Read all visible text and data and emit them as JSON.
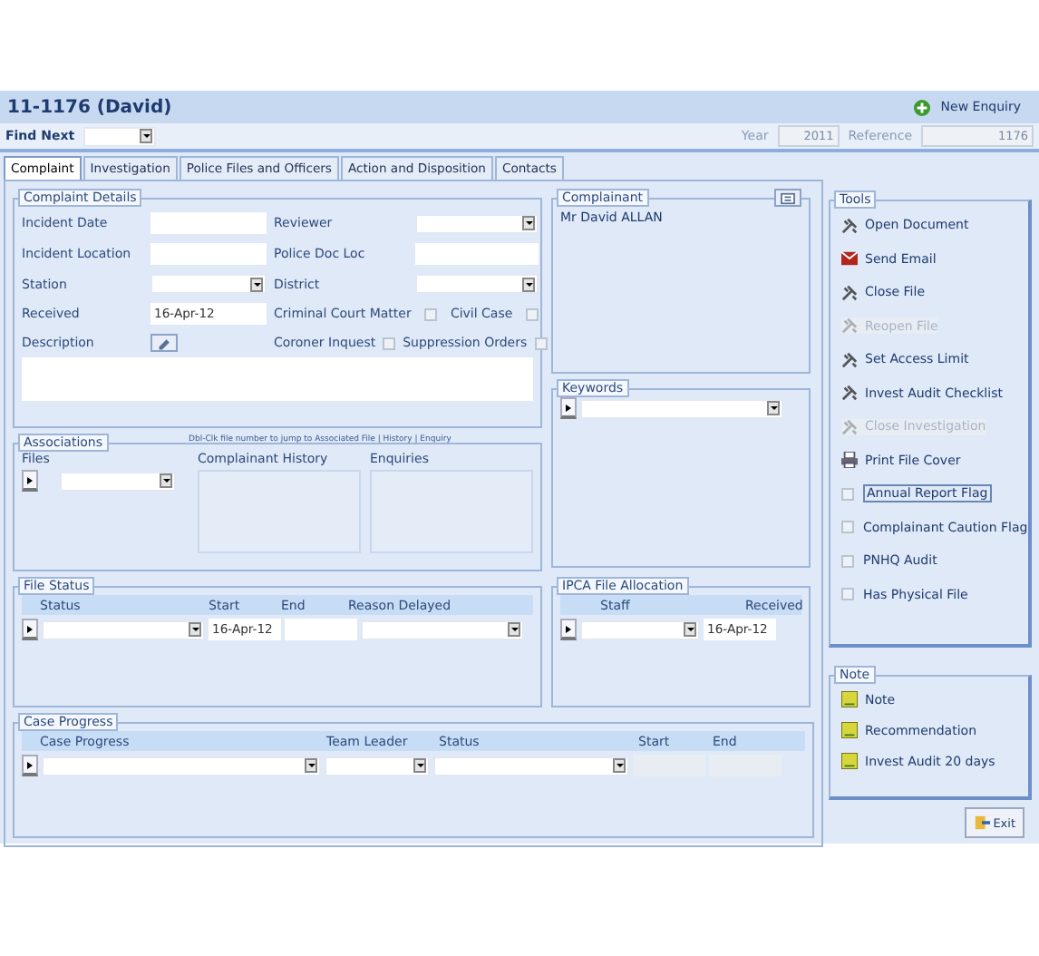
{
  "title": "11-1176 (David)",
  "new_enquiry": "New Enquiry",
  "find_next": {
    "label": "Find Next"
  },
  "year": {
    "label": "Year",
    "value": "2011"
  },
  "reference": {
    "label": "Reference",
    "value": "1176"
  },
  "tabs": [
    {
      "label": "Complaint",
      "selected": true
    },
    {
      "label": "Investigation",
      "selected": false
    },
    {
      "label": "Police Files and Officers",
      "selected": false
    },
    {
      "label": "Action and Disposition",
      "selected": false
    },
    {
      "label": "Contacts",
      "selected": false
    }
  ],
  "complaint_details": {
    "title": "Complaint Details",
    "rows": [
      {
        "left": {
          "label": "Incident Date",
          "kind": "text"
        },
        "right": {
          "label": "Reviewer",
          "kind": "dropdown"
        }
      },
      {
        "left": {
          "label": "Incident Location",
          "kind": "text"
        },
        "right": {
          "label": "Police Doc Loc",
          "kind": "text"
        }
      },
      {
        "left": {
          "label": "Station",
          "kind": "dropdown"
        },
        "right": {
          "label": "District",
          "kind": "dropdown"
        }
      },
      {
        "left": {
          "label": "Received",
          "kind": "text",
          "value": "16-Apr-12"
        },
        "right": {
          "kind": "checks",
          "checks": [
            {
              "label": "Criminal Court Matter",
              "checked": false
            },
            {
              "label": "Civil Case",
              "checked": false
            }
          ]
        }
      },
      {
        "left": {
          "label": "Description",
          "kind": "memo"
        },
        "right": {
          "kind": "checks",
          "checks": [
            {
              "label": "Coroner Inquest",
              "checked": false
            },
            {
              "label": "Suppression Orders",
              "checked": false
            }
          ]
        }
      }
    ]
  },
  "complainant": {
    "title": "Complainant",
    "name": "Mr David ALLAN"
  },
  "keywords": {
    "title": "Keywords"
  },
  "associations": {
    "title": "Associations",
    "hint": "Dbl-Clk file number to jump to Associated File | History | Enquiry",
    "lists": [
      {
        "title": "Files",
        "kind": "subform"
      },
      {
        "title": "Complainant History",
        "kind": "list"
      },
      {
        "title": "Enquiries",
        "kind": "list"
      }
    ]
  },
  "file_status": {
    "title": "File Status",
    "columns": [
      "Status",
      "Start",
      "End",
      "Reason Delayed"
    ],
    "start": "16-Apr-12"
  },
  "ipca": {
    "title": "IPCA File Allocation",
    "columns": [
      "Staff",
      "Received"
    ],
    "received": "16-Apr-12"
  },
  "case_progress": {
    "title": "Case Progress",
    "columns": [
      "Case Progress",
      "Team Leader",
      "Status",
      "Start",
      "End"
    ]
  },
  "tools": {
    "title": "Tools",
    "items": [
      {
        "label": "Open Document",
        "kind": "action",
        "disabled": false
      },
      {
        "label": "Send Email",
        "kind": "email",
        "disabled": false
      },
      {
        "label": "Close File",
        "kind": "action",
        "disabled": false
      },
      {
        "label": "Reopen File",
        "kind": "action",
        "disabled": true
      },
      {
        "label": "Set Access Limit",
        "kind": "action",
        "disabled": false
      },
      {
        "label": "Invest Audit Checklist",
        "kind": "action",
        "disabled": false
      },
      {
        "label": "Close Investigation",
        "kind": "action",
        "disabled": true
      },
      {
        "label": "Print File Cover",
        "kind": "print",
        "disabled": false
      },
      {
        "label": "Annual Report Flag",
        "kind": "check",
        "checked": false,
        "focused": true
      },
      {
        "label": "Complainant Caution Flag",
        "kind": "check",
        "checked": false,
        "focused": false
      },
      {
        "label": "PNHQ Audit",
        "kind": "check",
        "checked": false,
        "focused": false
      },
      {
        "label": "Has Physical File",
        "kind": "check",
        "checked": false,
        "focused": false
      }
    ]
  },
  "note": {
    "title": "Note",
    "items": [
      "Note",
      "Recommendation",
      "Invest Audit 20 days"
    ]
  },
  "exit": "Exit"
}
